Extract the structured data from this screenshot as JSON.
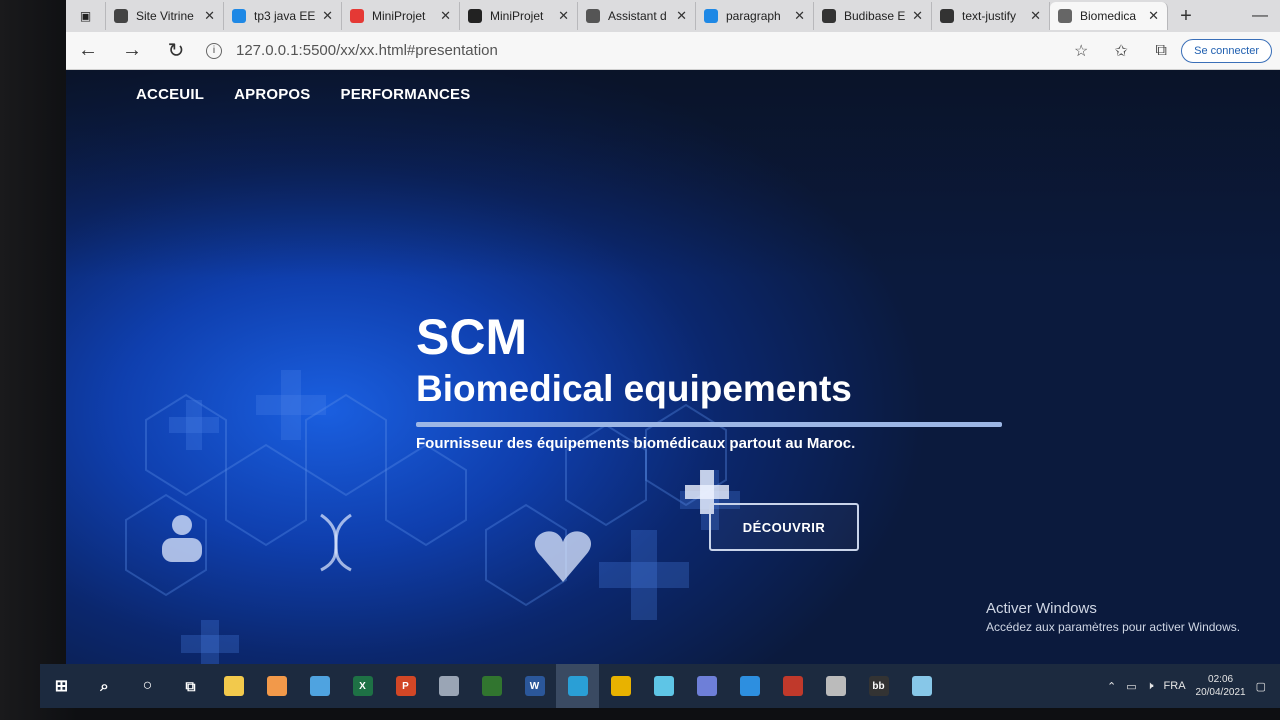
{
  "browser": {
    "tabs": [
      {
        "label": "Site Vitrine",
        "icon": "globe-icon",
        "color": "#444"
      },
      {
        "label": "tp3 java EE",
        "icon": "bing-icon",
        "color": "#1e88e5"
      },
      {
        "label": "MiniProjet",
        "icon": "youtube-icon",
        "color": "#e53935"
      },
      {
        "label": "MiniProjet",
        "icon": "github-icon",
        "color": "#222"
      },
      {
        "label": "Assistant d",
        "icon": "settings-icon",
        "color": "#555"
      },
      {
        "label": "paragraph",
        "icon": "bing-icon",
        "color": "#1e88e5"
      },
      {
        "label": "Budibase E",
        "icon": "budibase-icon",
        "color": "#333"
      },
      {
        "label": "text-justify",
        "icon": "codepen-icon",
        "color": "#333"
      },
      {
        "label": "Biomedica",
        "icon": "page-icon",
        "color": "#666"
      }
    ],
    "address": "127.0.0.1:5500/xx/xx.html#presentation",
    "sign_in": "Se connecter"
  },
  "nav": {
    "items": [
      "ACCEUIL",
      "APROPOS",
      "PERFORMANCES"
    ]
  },
  "hero": {
    "title": "SCM",
    "subtitle": "Biomedical equipements",
    "text": "Fournisseur des équipements biomédicaux partout au Maroc.",
    "button": "DÉCOUVRIR"
  },
  "activation": {
    "title": "Activer Windows",
    "text": "Accédez aux paramètres pour activer Windows."
  },
  "taskbar": {
    "apps": [
      {
        "name": "file-explorer-icon",
        "color": "#f2c94c"
      },
      {
        "name": "store-icon",
        "color": "#f2994a"
      },
      {
        "name": "mail-icon",
        "color": "#4fa3e0"
      },
      {
        "name": "excel-icon",
        "color": "#1e7145",
        "glyph": "X"
      },
      {
        "name": "powerpoint-icon",
        "color": "#d24726",
        "glyph": "P"
      },
      {
        "name": "app-icon",
        "color": "#9aa5b5"
      },
      {
        "name": "project-icon",
        "color": "#31752f"
      },
      {
        "name": "word-icon",
        "color": "#2b579a",
        "glyph": "W"
      },
      {
        "name": "edge-icon",
        "color": "#2a9fd6"
      },
      {
        "name": "chrome-icon",
        "color": "#e8b200"
      },
      {
        "name": "app2-icon",
        "color": "#5ec5e6"
      },
      {
        "name": "app3-icon",
        "color": "#6e7fd8"
      },
      {
        "name": "vscode-icon",
        "color": "#2d8fe0"
      },
      {
        "name": "app4-icon",
        "color": "#c0392b"
      },
      {
        "name": "app5-icon",
        "color": "#bbbbbb"
      },
      {
        "name": "budibase-taskbar-icon",
        "color": "#333",
        "glyph": "bb"
      },
      {
        "name": "app6-icon",
        "color": "#87c7e8"
      }
    ],
    "lang": "FRA",
    "time": "02:06",
    "date": "20/04/2021"
  }
}
